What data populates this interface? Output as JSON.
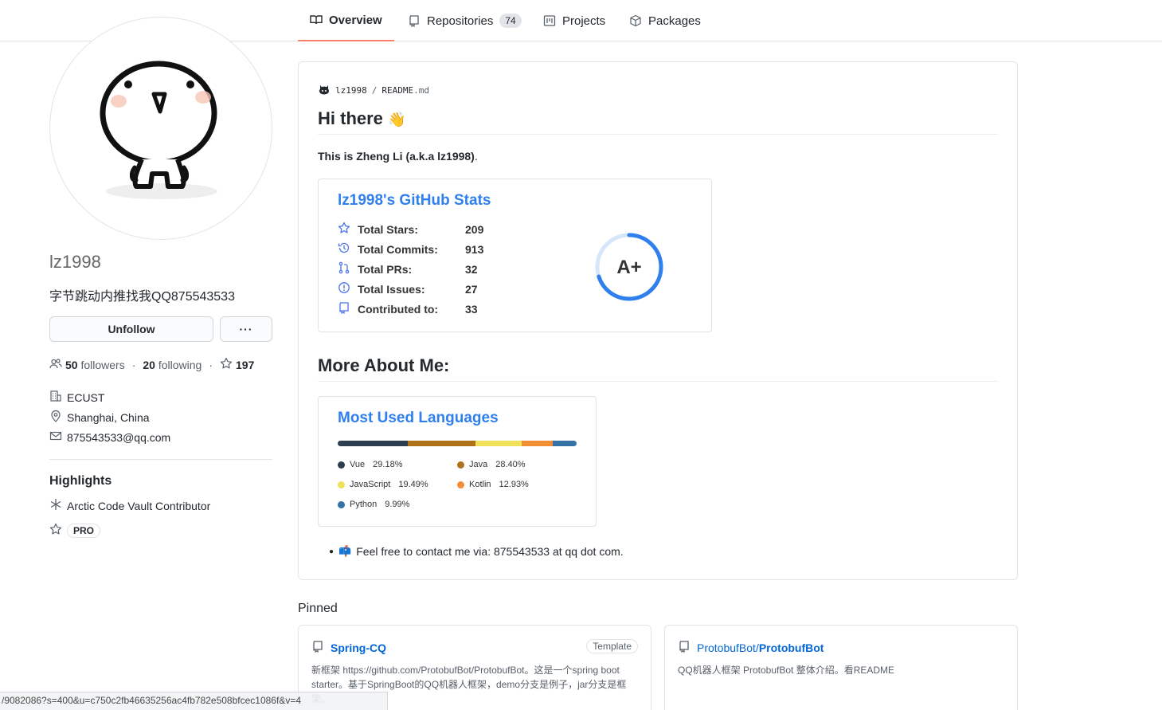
{
  "tabs": [
    {
      "label": "Overview",
      "icon": "book-icon",
      "active": true
    },
    {
      "label": "Repositories",
      "icon": "repo-icon",
      "count": "74"
    },
    {
      "label": "Projects",
      "icon": "project-icon"
    },
    {
      "label": "Packages",
      "icon": "package-icon"
    }
  ],
  "profile": {
    "username": "lz1998",
    "bio": "字节跳动内推找我QQ875543533",
    "unfollow_label": "Unfollow",
    "more_label": "···",
    "followers_count": "50",
    "followers_label": "followers",
    "following_count": "20",
    "following_label": "following",
    "stars_count": "197",
    "organization": "ECUST",
    "location": "Shanghai, China",
    "email": "875543533@qq.com"
  },
  "highlights": {
    "title": "Highlights",
    "items": [
      "Arctic Code Vault Contributor",
      "PRO"
    ]
  },
  "readme": {
    "owner": "lz1998",
    "separator": "/",
    "file_base": "README",
    "file_ext": ".md",
    "greeting": "Hi there",
    "greeting_emoji": "👋",
    "intro_main": "This is Zheng Li (a.k.a lz1998)",
    "intro_end": ".",
    "more_about": "More About Me:",
    "contact_emoji": "📫",
    "contact": "Feel free to contact me via: 875543533 at qq dot com."
  },
  "stats": {
    "title": "lz1998's GitHub Stats",
    "rows": [
      {
        "label": "Total Stars:",
        "value": "209",
        "icon": "star-icon"
      },
      {
        "label": "Total Commits:",
        "value": "913",
        "icon": "history-icon"
      },
      {
        "label": "Total PRs:",
        "value": "32",
        "icon": "pull-request-icon"
      },
      {
        "label": "Total Issues:",
        "value": "27",
        "icon": "issue-icon"
      },
      {
        "label": "Contributed to:",
        "value": "33",
        "icon": "repo-icon"
      }
    ],
    "rank": "A+",
    "rank_fraction": 0.7,
    "accent": "#2f80ed"
  },
  "languages": {
    "title": "Most Used Languages",
    "items": [
      {
        "name": "Vue",
        "percent": "29.18%",
        "value": 29.18,
        "color": "#2c3e50"
      },
      {
        "name": "Java",
        "percent": "28.40%",
        "value": 28.4,
        "color": "#b07219"
      },
      {
        "name": "JavaScript",
        "percent": "19.49%",
        "value": 19.49,
        "color": "#f1e05a"
      },
      {
        "name": "Kotlin",
        "percent": "12.93%",
        "value": 12.93,
        "color": "#F18E33"
      },
      {
        "name": "Python",
        "percent": "9.99%",
        "value": 9.99,
        "color": "#3572A5"
      }
    ]
  },
  "pinned": {
    "title": "Pinned",
    "repos": [
      {
        "owner": "",
        "name": "Spring-CQ",
        "badge": "Template",
        "desc": "新框架 https://github.com/ProtobufBot/ProtobufBot。这是一个spring boot starter。基于SpringBoot的QQ机器人框架，demo分支是例子，jar分支是框架。"
      },
      {
        "owner": "ProtobufBot/",
        "name": "ProtobufBot",
        "badge": "",
        "desc": "QQ机器人框架 ProtobufBot 整体介绍。看README"
      }
    ]
  },
  "status_url": "/9082086?s=400&u=c750c2fb46635256ac4fb782e508bfcec1086f&v=4"
}
